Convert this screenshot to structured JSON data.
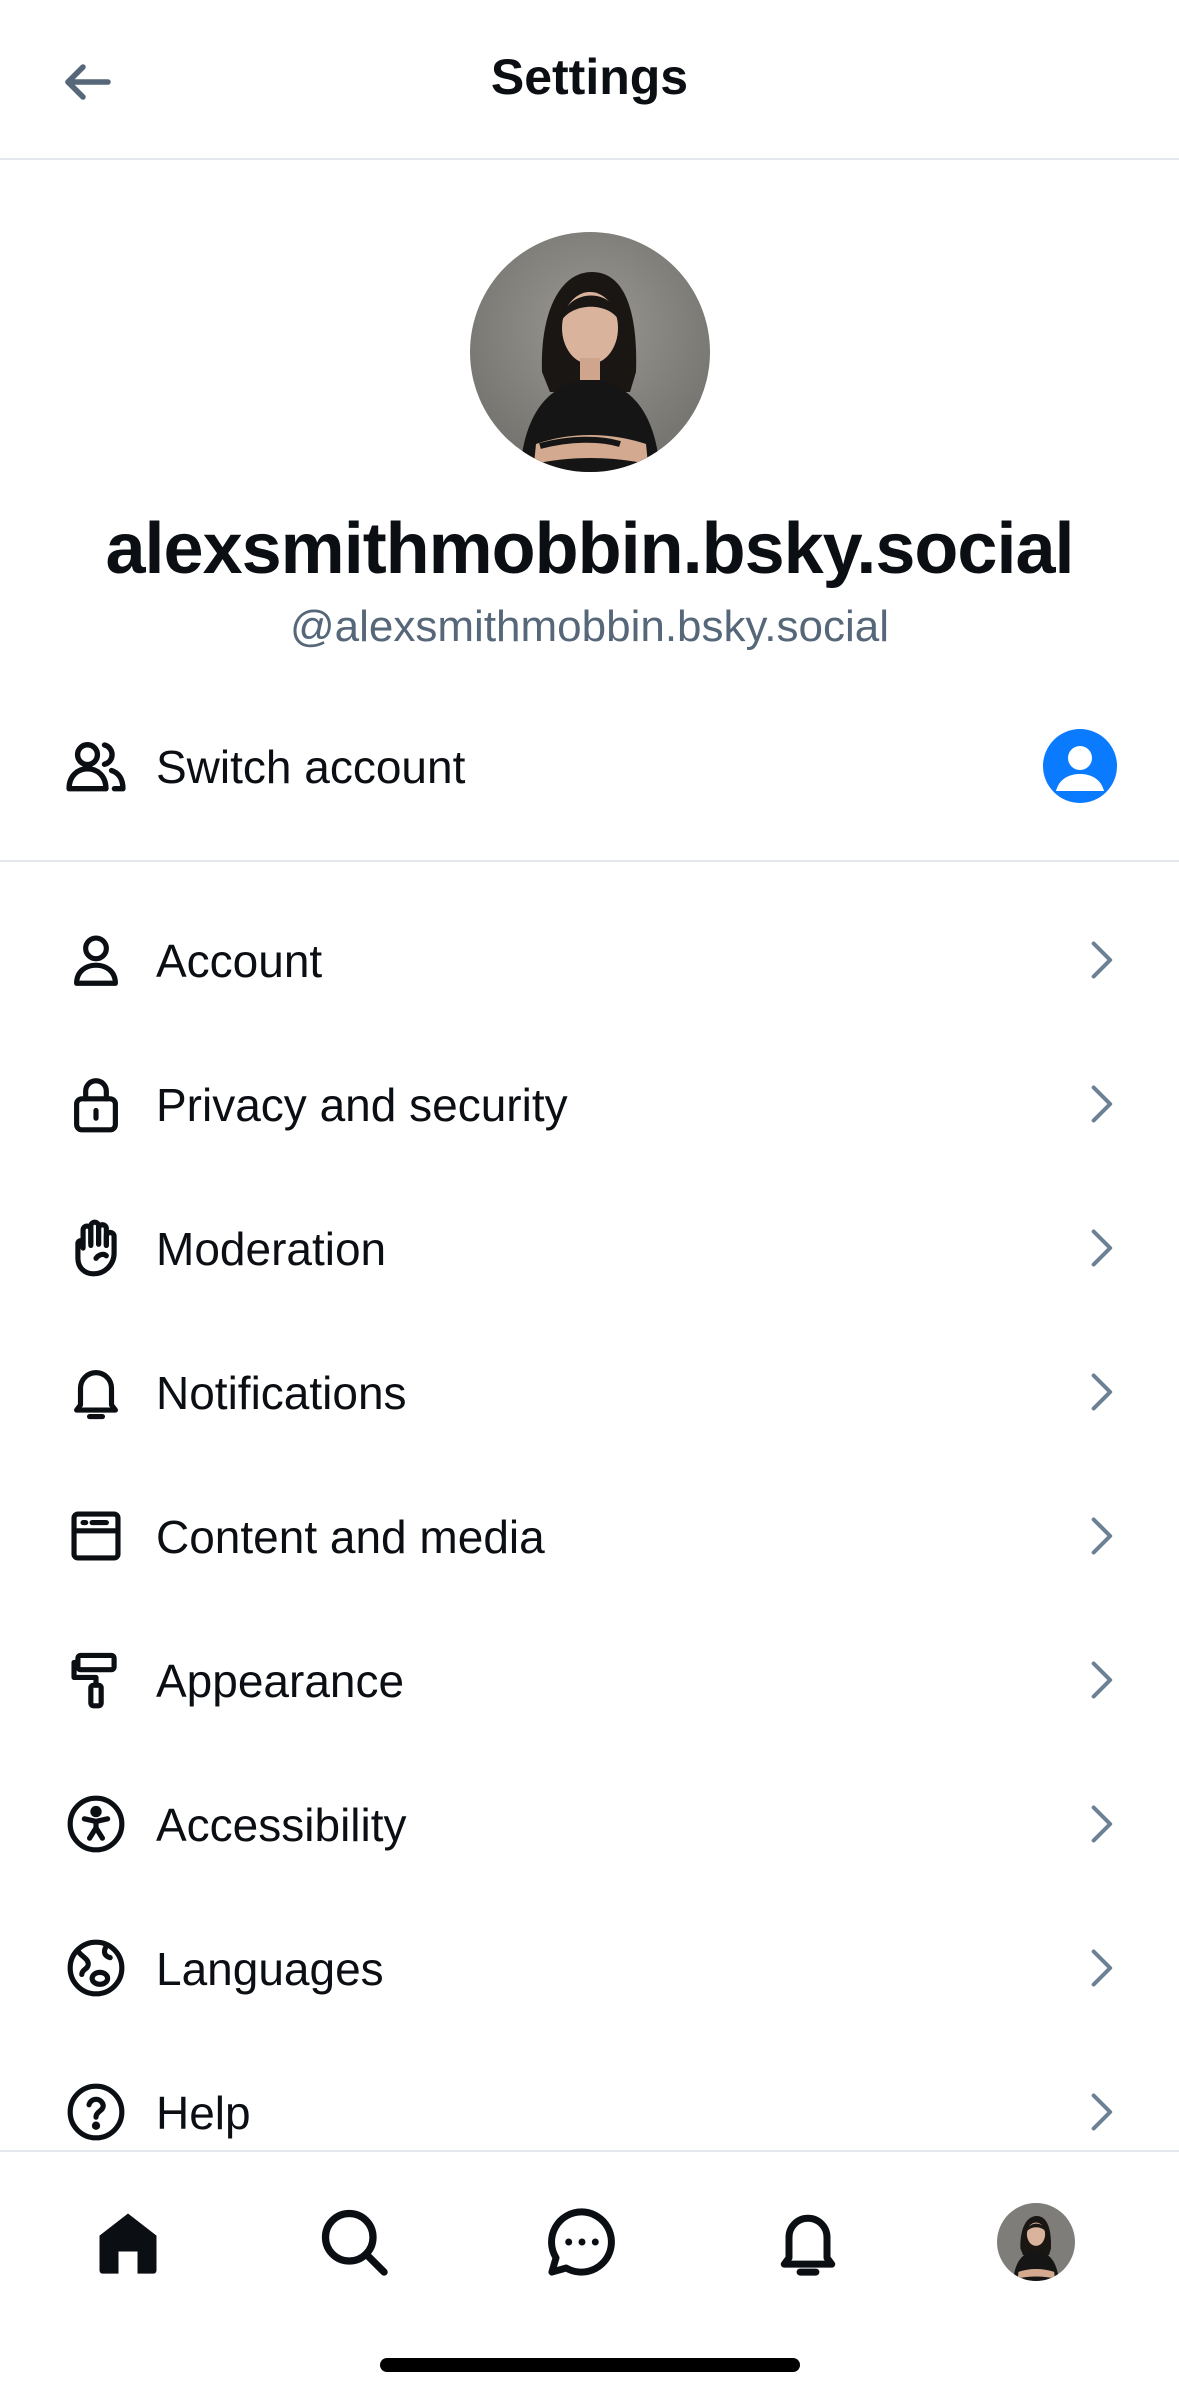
{
  "header": {
    "title": "Settings"
  },
  "profile": {
    "display_name": "alexsmithmobbin.bsky.social",
    "handle": "@alexsmithmobbin.bsky.social"
  },
  "switch_account": {
    "label": "Switch account"
  },
  "menu": [
    {
      "label": "Account",
      "icon": "person-icon"
    },
    {
      "label": "Privacy and security",
      "icon": "lock-icon"
    },
    {
      "label": "Moderation",
      "icon": "hand-icon"
    },
    {
      "label": "Notifications",
      "icon": "bell-icon"
    },
    {
      "label": "Content and media",
      "icon": "window-icon"
    },
    {
      "label": "Appearance",
      "icon": "paint-roller-icon"
    },
    {
      "label": "Accessibility",
      "icon": "accessibility-icon"
    },
    {
      "label": "Languages",
      "icon": "globe-icon"
    },
    {
      "label": "Help",
      "icon": "help-icon"
    }
  ],
  "tab_bar": {
    "items": [
      "home-icon",
      "search-icon",
      "chat-icon",
      "bell-icon",
      "profile-avatar"
    ]
  },
  "colors": {
    "accent": "#0a7aff",
    "text": "#0b0f14",
    "secondary_text": "#566779",
    "chevron": "#6b7f95",
    "divider": "#e4e8ec"
  }
}
